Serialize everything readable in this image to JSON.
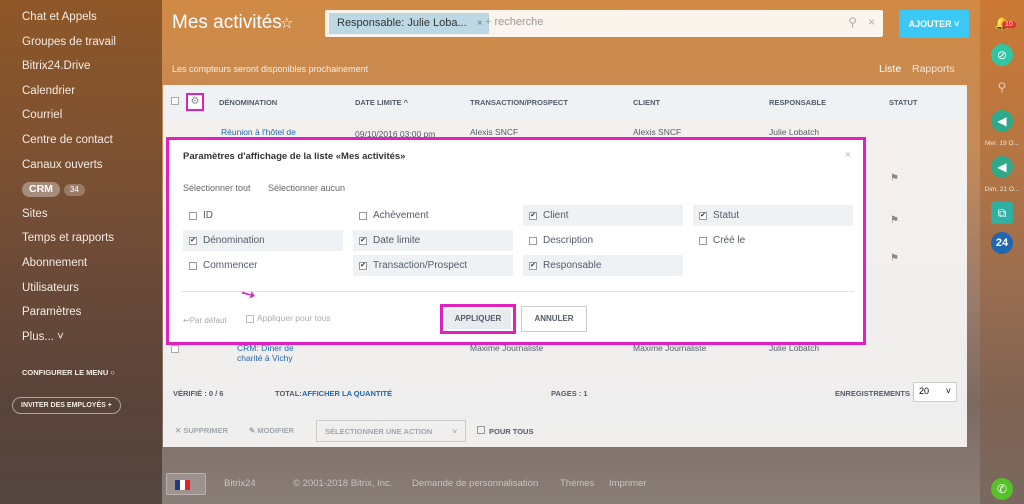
{
  "sidebar": {
    "items": [
      "Chat et Appels",
      "Groupes de travail",
      "Bitrix24.Drive",
      "Calendrier",
      "Courriel",
      "Centre de contact",
      "Canaux ouverts",
      "CRM",
      "Sites",
      "Temps et rapports",
      "Abonnement",
      "Utilisateurs",
      "Paramètres",
      "Plus... "
    ],
    "crm_count": "34",
    "configure": "CONFIGURER LE MENU",
    "invite": "INVITER DES EMPLOYÉS"
  },
  "header": {
    "title": "Mes activités",
    "filter_tag": "Responsable: Julie Loba...",
    "search_placeholder": "+ recherche",
    "add_button": "AJOUTER",
    "info": "Les compteurs seront disponibles prochainement",
    "view_list": "Liste",
    "view_reports": "Rapports"
  },
  "table": {
    "columns": [
      "DÉNOMINATION",
      "DATE LIMITE",
      "TRANSACTION/PROSPECT",
      "CLIENT",
      "RESPONSABLE",
      "STATUT"
    ],
    "row1": [
      "Réunion à l'hôtel de",
      "09/10/2016 03:00 pm",
      "Alexis SNCF",
      "Alexis SNCF",
      "Julie Lobatch"
    ],
    "row_last": [
      "CRM: Dîner de",
      "charité à Vichy",
      "Maxime Journaliste",
      "Maxime Journaliste",
      "Julie Lobatch"
    ],
    "footer": {
      "selected": "VÉRIFIÉ : 0 / 6",
      "total_label": "TOTAL:",
      "total_link": "AFFICHER LA QUANTITÉ",
      "pages": "PAGES : 1",
      "records": "ENREGISTREMENTS :",
      "per_page": "20"
    },
    "actions": {
      "delete": "SUPPRIMER",
      "edit": "MODIFIER",
      "select": "SÉLECTIONNER UNE ACTION",
      "for_all": "POUR TOUS"
    }
  },
  "modal": {
    "title": "Paramètres d'affichage de la liste «Mes activités»",
    "select_all": "Sélectionner tout",
    "select_none": "Sélectionner aucun",
    "options": [
      {
        "label": "ID",
        "checked": false
      },
      {
        "label": "Achèvement",
        "checked": false
      },
      {
        "label": "Client",
        "checked": true
      },
      {
        "label": "Statut",
        "checked": true
      },
      {
        "label": "Dénomination",
        "checked": true
      },
      {
        "label": "Date limite",
        "checked": true
      },
      {
        "label": "Description",
        "checked": false
      },
      {
        "label": "Créé le",
        "checked": false
      },
      {
        "label": "Commencer",
        "checked": false
      },
      {
        "label": "Transaction/Prospect",
        "checked": true
      },
      {
        "label": "Responsable",
        "checked": true
      }
    ],
    "default": "Par défaut",
    "apply_all": "Appliquer pour tous",
    "apply": "APPLIQUER",
    "cancel": "ANNULER"
  },
  "footer": {
    "brand": "Bitrix24",
    "copyright": "© 2001-2018 Bitrix, Inc.",
    "customize": "Demande de personnalisation",
    "themes": "Thèmes",
    "print": "Imprimer"
  },
  "rightbar": {
    "badge": "10",
    "date1": "Mer. 19 O...",
    "date2": "Dim. 21 O...",
    "b24": "24"
  },
  "colors": {
    "accent": "#3bc8f5",
    "highlight": "#e020c0"
  }
}
